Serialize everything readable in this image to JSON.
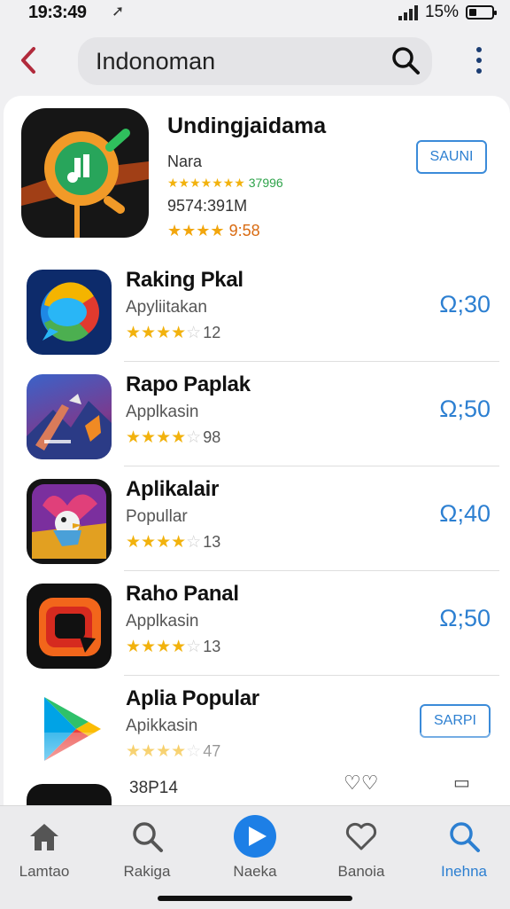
{
  "status_bar": {
    "time": "19:3:49",
    "location_icon": "location-arrow-icon",
    "battery_percent": "15%"
  },
  "header": {
    "back_icon": "chevron-left-icon",
    "search_text": "Indonoman",
    "search_icon": "search-icon",
    "more_icon": "more-vertical-icon"
  },
  "featured": {
    "title": "Undingjaidama",
    "subtitle": "Nara",
    "rating_stars": "★★★★★★★",
    "rating_count": "37996",
    "size": "9574:391M",
    "rating2_stars": "★★★★",
    "rating2_value": "9:58",
    "button_label": "SAUNI"
  },
  "apps": [
    {
      "name": "Raking Pkal",
      "category": "Apyliitakan",
      "stars": "★★★★",
      "stars_off": "☆",
      "count": "12",
      "price": "Ω;30"
    },
    {
      "name": "Rapo Paplak",
      "category": "Applkasin",
      "stars": "★★★★",
      "stars_off": "☆",
      "count": "98",
      "price": "Ω;50"
    },
    {
      "name": "Aplikalair",
      "category": "Popullar",
      "stars": "★★★★",
      "stars_off": "☆",
      "count": "13",
      "price": "Ω;40"
    },
    {
      "name": "Raho Panal",
      "category": "Applkasin",
      "stars": "★★★★",
      "stars_off": "☆",
      "count": "13",
      "price": "Ω;50"
    },
    {
      "name": "Aplia Popular",
      "category": "Apikkasin",
      "stars": "★★★★",
      "stars_off": "☆",
      "count": "47",
      "button": "SARPI"
    }
  ],
  "peek": {
    "text": "38P14",
    "heart": "♡♡"
  },
  "tabs": [
    {
      "label": "Lamtao",
      "icon": "home-icon"
    },
    {
      "label": "Rakiga",
      "icon": "search-icon"
    },
    {
      "label": "Naeka",
      "icon": "play-icon"
    },
    {
      "label": "Banoia",
      "icon": "heart-icon"
    },
    {
      "label": "Inehna",
      "icon": "search-icon",
      "active": true
    }
  ],
  "colors": {
    "accent": "#2c7fd1",
    "back": "#b12a3c",
    "star": "#f2b20d"
  }
}
